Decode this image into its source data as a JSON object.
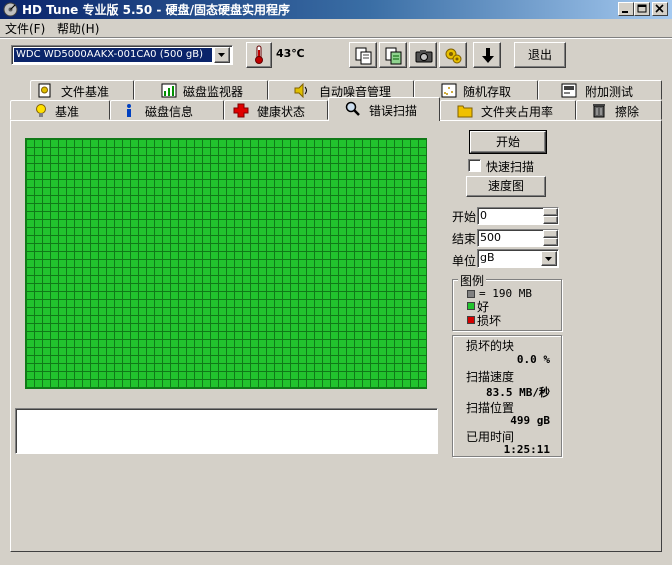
{
  "window": {
    "title": "HD Tune 专业版 5.50 - 硬盘/固态硬盘实用程序",
    "colors": {
      "titlebar_start": "#0a246a",
      "titlebar_end": "#a6caf0",
      "face": "#d4d0c8",
      "good_block": "#22c32e",
      "bad_block": "#d40000",
      "temperature_icon": "#c00000"
    }
  },
  "menu": {
    "file": "文件(F)",
    "help": "帮助(H)"
  },
  "toolbar": {
    "drive": "WDC WD5000AAKX-001CA0 (500 gB)",
    "temperature": "43℃",
    "icons": [
      "copy-icon",
      "copy-info-icon",
      "screenshot-camera-icon",
      "settings-icon",
      "save-down-arrow-icon"
    ],
    "exit": "退出"
  },
  "tabs": {
    "row1": [
      "文件基准",
      "磁盘监视器",
      "自动噪音管理",
      "随机存取",
      "附加测试"
    ],
    "row2": [
      "基准",
      "磁盘信息",
      "健康状态",
      "错误扫描",
      "文件夹占用率",
      "擦除"
    ],
    "active": "错误扫描"
  },
  "scan": {
    "start_button": "开始",
    "quick_scan_label": "快速扫描",
    "quick_scan_checked": false,
    "speed_map_button": "速度图",
    "start_label": "开始",
    "start_value": "0",
    "end_label": "结束",
    "end_value": "500",
    "unit_label": "单位",
    "unit_value": "gB"
  },
  "legend": {
    "title": "图例",
    "block_size": "= 190 MB",
    "good": "好",
    "bad": "损坏"
  },
  "stats": {
    "damaged_label": "损坏的块",
    "damaged_value": "0.0 %",
    "speed_label": "扫描速度",
    "speed_value": "83.5 MB/秒",
    "position_label": "扫描位置",
    "position_value": "499 gB",
    "elapsed_label": "已用时间",
    "elapsed_value": "1:25:11"
  }
}
